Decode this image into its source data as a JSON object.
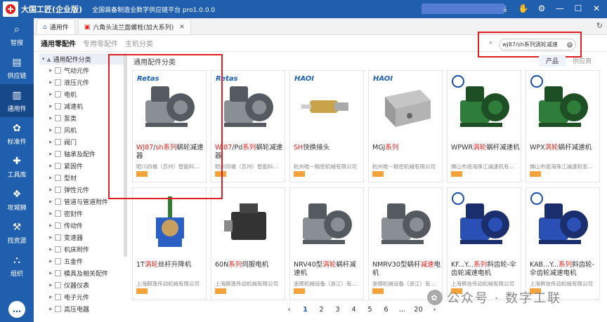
{
  "app": {
    "name": "大国工匠(企业版)",
    "subtitle": "全国装备制造业数字供应链平台 pro1.0.0.0"
  },
  "sidebar": [
    {
      "label": "智搜",
      "icon": "search-icon"
    },
    {
      "label": "供应链",
      "icon": "supply-chain-icon"
    },
    {
      "label": "通用件",
      "icon": "common-parts-icon"
    },
    {
      "label": "标准件",
      "icon": "standard-parts-icon"
    },
    {
      "label": "工具库",
      "icon": "tools-icon"
    },
    {
      "label": "攻城狮",
      "icon": "engineer-icon"
    },
    {
      "label": "找资源",
      "icon": "resource-icon"
    },
    {
      "label": "组织",
      "icon": "org-icon"
    }
  ],
  "tabs": [
    {
      "label": "通用件"
    },
    {
      "label": "六角头法兰面螺栓(加大系列)"
    }
  ],
  "subnav": [
    "通用零配件",
    "专用零配件",
    "主机分类"
  ],
  "search": {
    "value": "wj87/sh系列涡轮减速"
  },
  "product_tabs": [
    "产品",
    "供应商"
  ],
  "tree": {
    "root": "通用配件分类",
    "items": [
      "气动元件",
      "液压元件",
      "电机",
      "减速机",
      "泵类",
      "风机",
      "阀门",
      "轴承及配件",
      "紧固件",
      "型材",
      "弹性元件",
      "管道与管道附件",
      "密封件",
      "传动件",
      "变速器",
      "机床附件",
      "五金件",
      "模具及相关配件",
      "仪器仪表",
      "电子元件",
      "高压电器"
    ]
  },
  "grid_title": "通用配件分类",
  "products": [
    {
      "name_hl": "WJ87",
      "name_rest": "/",
      "name_hl2": "sh系列",
      "name_tail": "蜗轮减速器",
      "company": "昭川四福（苏州）智能科...",
      "brand": "Retas"
    },
    {
      "name_hl": "WJ87",
      "name_rest": "/Pd",
      "name_hl2": "系列",
      "name_tail": "蜗轮减速器",
      "company": "昭川四福（苏州）智能科...",
      "brand": "Retas"
    },
    {
      "name_hl": "SH",
      "name_rest": "",
      "name_hl2": "",
      "name_tail": "快换接头",
      "company": "杭州皓一精密机械有限公司",
      "brand": "HAOI"
    },
    {
      "name_hl": "",
      "name_rest": "MGJ",
      "name_hl2": "系列",
      "name_tail": "",
      "company": "杭州皓一精密机械有限公司",
      "brand": "HAOI"
    },
    {
      "name_hl": "",
      "name_rest": "WPWR",
      "name_hl2": "涡轮",
      "name_tail": "蜗杆减速机",
      "company": "佛山市南海珠江减速机有...",
      "brand": ""
    },
    {
      "name_hl": "",
      "name_rest": "WPX",
      "name_hl2": "涡轮",
      "name_tail": "蜗杆减速机",
      "company": "佛山市南海珠江减速机有...",
      "brand": ""
    },
    {
      "name_hl": "",
      "name_rest": "1T",
      "name_hl2": "涡轮",
      "name_tail": "丝杆升降机",
      "company": "上海麒逸传动机械有限公司",
      "brand": ""
    },
    {
      "name_hl": "",
      "name_rest": "60N",
      "name_hl2": "系列",
      "name_tail": "伺服电机",
      "company": "上海麒逸传动机械有限公司",
      "brand": ""
    },
    {
      "name_hl": "",
      "name_rest": "NRV40型",
      "name_hl2": "涡轮",
      "name_tail": "蜗杆减速机",
      "company": "浙辉机械设备（浙江）有...",
      "brand": ""
    },
    {
      "name_hl": "",
      "name_rest": "NMRV30型蜗杆",
      "name_hl2": "减速",
      "name_tail": "电机",
      "company": "浙辉机械设备（浙江）有...",
      "brand": ""
    },
    {
      "name_hl": "",
      "name_rest": "KF...Y...",
      "name_hl2": "系列",
      "name_tail": "斜齿轮-伞齿轮减速电机",
      "company": "上海枫信传动机械有限公司",
      "brand": ""
    },
    {
      "name_hl": "",
      "name_rest": "KAB...Y...",
      "name_hl2": "系列",
      "name_tail": "斜齿轮-伞齿轮减速电机",
      "company": "上海枫信传动机械有限公司",
      "brand": ""
    }
  ],
  "pager": [
    "‹",
    "1",
    "2",
    "3",
    "4",
    "5",
    "6",
    "...",
    "20",
    "›"
  ],
  "pager_current": "1",
  "watermark": "公众号 · 数字工联",
  "colors": {
    "primary": "#1f5fae",
    "highlight": "#e0201a",
    "annotation": "#e02020"
  }
}
